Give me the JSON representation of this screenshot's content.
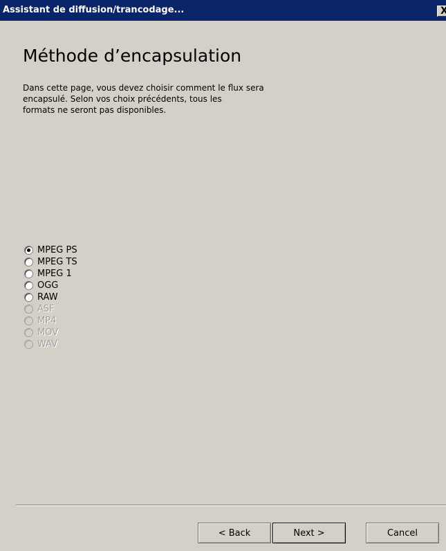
{
  "window": {
    "title": "Assistant de diffusion/trancodage...",
    "close_label": "X"
  },
  "page": {
    "heading": "Méthode d’encapsulation",
    "description_lines": [
      "Dans cette page, vous devez choisir comment le flux sera",
      "encapsulé. Selon vos choix précédents, tous les",
      "formats ne seront pas disponibles."
    ]
  },
  "encapsulation": {
    "selected": "MPEG PS",
    "options": [
      {
        "label": "MPEG PS",
        "checked": true,
        "enabled": true
      },
      {
        "label": "MPEG TS",
        "checked": false,
        "enabled": true
      },
      {
        "label": "MPEG 1",
        "checked": false,
        "enabled": true
      },
      {
        "label": "OGG",
        "checked": false,
        "enabled": true
      },
      {
        "label": "RAW",
        "checked": false,
        "enabled": true
      },
      {
        "label": "ASF",
        "checked": false,
        "enabled": false
      },
      {
        "label": "MP4",
        "checked": false,
        "enabled": false
      },
      {
        "label": "MOV",
        "checked": false,
        "enabled": false
      },
      {
        "label": "WAV",
        "checked": false,
        "enabled": false
      }
    ]
  },
  "buttons": {
    "back_label": "< Back",
    "next_label": "Next >",
    "cancel_label": "Cancel"
  },
  "colors": {
    "titlebar": "#0a246a",
    "background": "#d4d0c8",
    "disabled_text": "#a0a0a0"
  }
}
